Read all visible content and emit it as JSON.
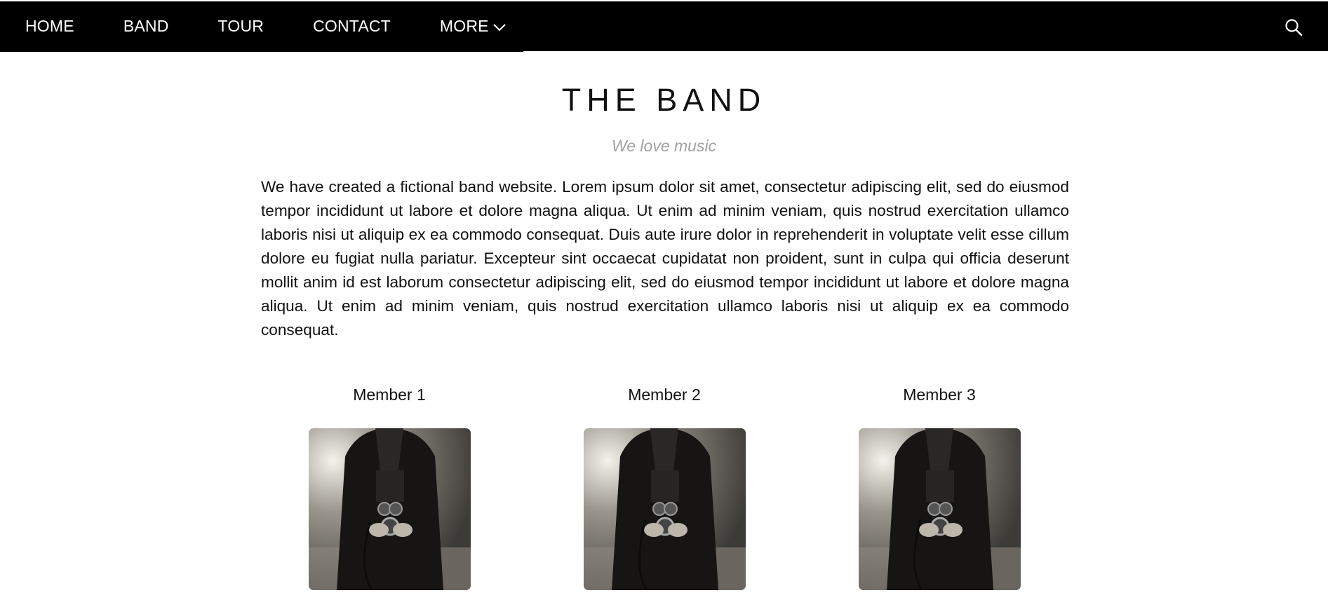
{
  "nav": {
    "items": [
      {
        "label": "HOME"
      },
      {
        "label": "BAND"
      },
      {
        "label": "TOUR"
      },
      {
        "label": "CONTACT"
      },
      {
        "label": "MORE",
        "icon": "chevron-down-icon"
      }
    ],
    "search_icon": "search-icon"
  },
  "band": {
    "title": "THE BAND",
    "subtitle": "We love music",
    "description": "We have created a fictional band website. Lorem ipsum dolor sit amet, consectetur adipiscing elit, sed do eiusmod tempor incididunt ut labore et dolore magna aliqua. Ut enim ad minim veniam, quis nostrud exercitation ullamco laboris nisi ut aliquip ex ea commodo consequat. Duis aute irure dolor in reprehenderit in voluptate velit esse cillum dolore eu fugiat nulla pariatur. Excepteur sint occaecat cupidatat non proident, sunt in culpa qui officia deserunt mollit anim id est laborum consectetur adipiscing elit, sed do eiusmod tempor incididunt ut labore et dolore magna aliqua. Ut enim ad minim veniam, quis nostrud exercitation ullamco laboris nisi ut aliquip ex ea commodo consequat.",
    "members": [
      {
        "name": "Member 1"
      },
      {
        "name": "Member 2"
      },
      {
        "name": "Member 3"
      }
    ]
  },
  "colors": {
    "nav_background": "#000000",
    "nav_text": "#ffffff",
    "subtitle": "#a0a0a0"
  }
}
